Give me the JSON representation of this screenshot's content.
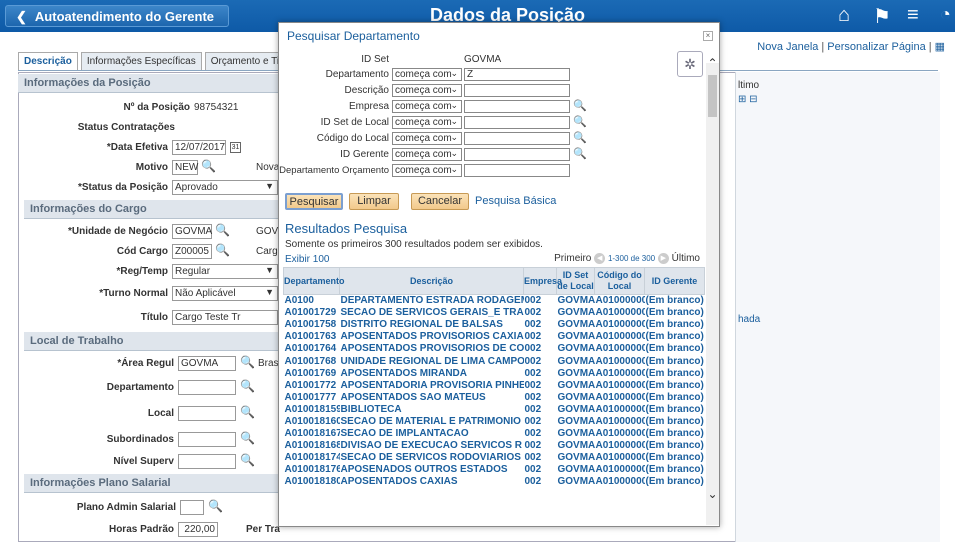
{
  "banner": {
    "back_label": "Autoatendimento do Gerente",
    "title": "Dados da Posição",
    "icons": [
      "home-icon",
      "flag-icon",
      "menu-icon",
      "navbar-icon"
    ]
  },
  "page_links": {
    "new_window": "Nova Janela",
    "personalize": "Personalizar Página"
  },
  "tabs": [
    {
      "label": "Descrição"
    },
    {
      "label": "Informações Específicas"
    },
    {
      "label": "Orçamento e Titular"
    }
  ],
  "background": {
    "pos_info_header": "Informações da Posição",
    "position_number_label": "Nº da Posição",
    "position_number": "98754321",
    "hiring_status_label": "Status Contratações",
    "effective_date_label": "*Data Efetiva",
    "effective_date": "12/07/2017",
    "reason_label": "Motivo",
    "reason_value": "NEW",
    "reason_desc": "Nova",
    "position_status_label": "*Status da Posição",
    "position_status": "Aprovado",
    "job_header": "Informações do Cargo",
    "business_unit_label": "*Unidade de Negócio",
    "business_unit": "GOVMA",
    "business_unit_desc": "GOVI",
    "job_code_label": "Cód Cargo",
    "job_code": "Z00005",
    "job_code_desc": "Cargo",
    "reg_temp_label": "*Reg/Temp",
    "reg_temp": "Regular",
    "shift_label": "*Turno Normal",
    "shift": "Não Aplicável",
    "title_label": "Título",
    "title_value": "Cargo Teste Tr",
    "workplace_header": "Local de Trabalho",
    "reg_region_label": "*Área Regul",
    "reg_region": "GOVMA",
    "reg_region_desc": "Bras",
    "department_label": "Departamento",
    "location_label": "Local",
    "subordinates_label": "Subordinados",
    "supervisor_label": "Nível Superv",
    "salary_header": "Informações Plano Salarial",
    "salary_plan_label": "Plano Admin Salarial",
    "std_hours_label": "Horas Padrão",
    "std_hours": "220,00",
    "per_label": "Per Tra",
    "right_col_last": "ltimo",
    "right_col_hada": "hada"
  },
  "modal": {
    "title": "Pesquisar Departamento",
    "setid_label": "ID Set",
    "setid_value": "GOVMA",
    "fields": [
      {
        "label": "Departamento",
        "operator": "começa com",
        "value": "Z",
        "lookup": false
      },
      {
        "label": "Descrição",
        "operator": "começa com",
        "value": "",
        "lookup": false
      },
      {
        "label": "Empresa",
        "operator": "começa com",
        "value": "",
        "lookup": true
      },
      {
        "label": "ID Set de Local",
        "operator": "começa com",
        "value": "",
        "lookup": true
      },
      {
        "label": "Código do Local",
        "operator": "começa com",
        "value": "",
        "lookup": true
      },
      {
        "label": "ID Gerente",
        "operator": "começa com",
        "value": "",
        "lookup": true
      },
      {
        "label": "Departamento Orçamento",
        "operator": "começa com",
        "value": "",
        "lookup": false
      }
    ],
    "buttons": {
      "search": "Pesquisar",
      "clear": "Limpar",
      "cancel": "Cancelar",
      "basic_search": "Pesquisa Básica"
    },
    "results_title": "Resultados Pesquisa",
    "results_note": "Somente os primeiros 300 resultados podem ser exibidos.",
    "show_label": "Exibir 100",
    "nav_first": "Primeiro",
    "nav_range": "1-300 de 300",
    "nav_last": "Último",
    "columns": [
      "Departamento",
      "Descrição",
      "Empresa",
      "ID Set de Local",
      "Código do Local",
      "ID Gerente"
    ],
    "rows": [
      [
        "A0100",
        "DEPARTAMENTO ESTRADA RODAGEM",
        "002",
        "GOVMA",
        "A010000001",
        "(Em branco)"
      ],
      [
        "A01001729",
        "SECAO DE SERVICOS GERAIS_E TRA",
        "002",
        "GOVMA",
        "A010000001",
        "(Em branco)"
      ],
      [
        "A01001758",
        "DISTRITO REGIONAL DE BALSAS",
        "002",
        "GOVMA",
        "A010000001",
        "(Em branco)"
      ],
      [
        "A01001763",
        "APOSENTADOS PROVISORIOS CAXIAS",
        "002",
        "GOVMA",
        "A010000001",
        "(Em branco)"
      ],
      [
        "A01001764",
        "APOSENTADOS PROVISORIOS DE COL",
        "002",
        "GOVMA",
        "A010000001",
        "(Em branco)"
      ],
      [
        "A01001768",
        "UNIDADE REGIONAL DE LIMA CAMPO",
        "002",
        "GOVMA",
        "A010000001",
        "(Em branco)"
      ],
      [
        "A01001769",
        "APOSENTADOS MIRANDA",
        "002",
        "GOVMA",
        "A010000001",
        "(Em branco)"
      ],
      [
        "A01001772",
        "APOSENTADORIA PROVISORIA PINHE",
        "002",
        "GOVMA",
        "A010000001",
        "(Em branco)"
      ],
      [
        "A01001777",
        "APOSENTADOS SAO MATEUS",
        "002",
        "GOVMA",
        "A010000001",
        "(Em branco)"
      ],
      [
        "A010018159",
        "BIBLIOTECA",
        "002",
        "GOVMA",
        "A010000001",
        "(Em branco)"
      ],
      [
        "A010018160",
        "SECAO DE MATERIAL E PATRIMONIO",
        "002",
        "GOVMA",
        "A010000001",
        "(Em branco)"
      ],
      [
        "A010018167",
        "SECAO DE IMPLANTACAO",
        "002",
        "GOVMA",
        "A010000001",
        "(Em branco)"
      ],
      [
        "A010018168",
        "DIVISAO DE EXECUCAO SERVICOS R",
        "002",
        "GOVMA",
        "A010000001",
        "(Em branco)"
      ],
      [
        "A010018174",
        "SECAO DE SERVICOS RODOVIARIOS",
        "002",
        "GOVMA",
        "A010000001",
        "(Em branco)"
      ],
      [
        "A010018176",
        "APOSENADOS OUTROS ESTADOS",
        "002",
        "GOVMA",
        "A010000001",
        "(Em branco)"
      ],
      [
        "A010018180",
        "APOSENTADOS CAXIAS",
        "002",
        "GOVMA",
        "A010000001",
        "(Em branco)"
      ]
    ]
  }
}
